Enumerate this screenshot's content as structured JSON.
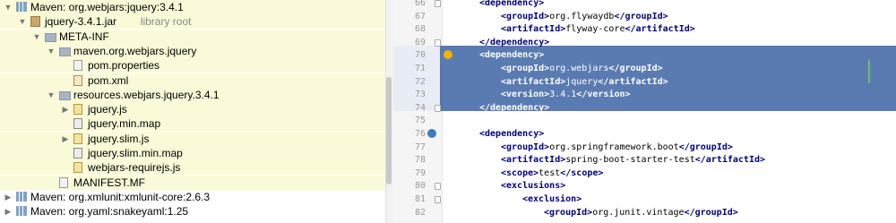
{
  "project_tree": {
    "rows": [
      {
        "label": "Maven: org.webjars:jquery:3.4.1",
        "suffix": "",
        "arrow": "▼",
        "icon": "library-icon"
      },
      {
        "label": "jquery-3.4.1.jar",
        "suffix": "library root",
        "arrow": "▼",
        "icon": "jar-icon"
      },
      {
        "label": "META-INF",
        "suffix": "",
        "arrow": "▼",
        "icon": "folder-icon"
      },
      {
        "label": "maven.org.webjars.jquery",
        "suffix": "",
        "arrow": "▼",
        "icon": "package-icon"
      },
      {
        "label": "pom.properties",
        "suffix": "",
        "arrow": "",
        "icon": "properties-file-icon"
      },
      {
        "label": "pom.xml",
        "suffix": "",
        "arrow": "",
        "icon": "xml-file-icon"
      },
      {
        "label": "resources.webjars.jquery.3.4.1",
        "suffix": "",
        "arrow": "▼",
        "icon": "package-icon"
      },
      {
        "label": "jquery.js",
        "suffix": "",
        "arrow": "▶",
        "icon": "js-file-icon"
      },
      {
        "label": "jquery.min.map",
        "suffix": "",
        "arrow": "",
        "icon": "map-file-icon"
      },
      {
        "label": "jquery.slim.js",
        "suffix": "",
        "arrow": "▶",
        "icon": "js-file-icon"
      },
      {
        "label": "jquery.slim.min.map",
        "suffix": "",
        "arrow": "",
        "icon": "map-file-icon"
      },
      {
        "label": "webjars-requirejs.js",
        "suffix": "",
        "arrow": "",
        "icon": "js-file-icon"
      },
      {
        "label": "MANIFEST.MF",
        "suffix": "",
        "arrow": "",
        "icon": "manifest-file-icon"
      },
      {
        "label": "Maven: org.xmlunit:xmlunit-core:2.6.3",
        "suffix": "",
        "arrow": "▶",
        "icon": "library-icon"
      },
      {
        "label": "Maven: org.yaml:snakeyaml:1.25",
        "suffix": "",
        "arrow": "▶",
        "icon": "library-icon"
      }
    ]
  },
  "editor": {
    "lines": [
      {
        "num": "66",
        "parts": [
          {
            "t": "tag",
            "v": "<dependency>"
          }
        ]
      },
      {
        "num": "67",
        "parts": [
          {
            "t": "tag",
            "v": "<groupId>"
          },
          {
            "t": "txt",
            "v": "org.flywaydb"
          },
          {
            "t": "tag",
            "v": "</groupId>"
          }
        ]
      },
      {
        "num": "68",
        "parts": [
          {
            "t": "tag",
            "v": "<artifactId>"
          },
          {
            "t": "txt",
            "v": "flyway-core"
          },
          {
            "t": "tag",
            "v": "</artifactId>"
          }
        ]
      },
      {
        "num": "69",
        "parts": [
          {
            "t": "tag",
            "v": "</dependency>"
          }
        ]
      },
      {
        "num": "70",
        "parts": [
          {
            "t": "tag",
            "v": "<dependency>"
          }
        ]
      },
      {
        "num": "71",
        "parts": [
          {
            "t": "tag",
            "v": "<groupId>"
          },
          {
            "t": "txt",
            "v": "org.webjars"
          },
          {
            "t": "tag",
            "v": "</groupId>"
          }
        ]
      },
      {
        "num": "72",
        "parts": [
          {
            "t": "tag",
            "v": "<artifactId>"
          },
          {
            "t": "txt",
            "v": "jquery"
          },
          {
            "t": "tag",
            "v": "</artifactId>"
          }
        ]
      },
      {
        "num": "73",
        "parts": [
          {
            "t": "tag",
            "v": "<version>"
          },
          {
            "t": "txt",
            "v": "3.4.1"
          },
          {
            "t": "tag",
            "v": "</version>"
          }
        ]
      },
      {
        "num": "74",
        "parts": [
          {
            "t": "tag",
            "v": "</dependency>"
          }
        ]
      },
      {
        "num": "75",
        "parts": []
      },
      {
        "num": "76",
        "parts": [
          {
            "t": "tag",
            "v": "<dependency>"
          }
        ]
      },
      {
        "num": "77",
        "parts": [
          {
            "t": "tag",
            "v": "<groupId>"
          },
          {
            "t": "txt",
            "v": "org.springframework.boot"
          },
          {
            "t": "tag",
            "v": "</groupId>"
          }
        ]
      },
      {
        "num": "78",
        "parts": [
          {
            "t": "tag",
            "v": "<artifactId>"
          },
          {
            "t": "txt",
            "v": "spring-boot-starter-test"
          },
          {
            "t": "tag",
            "v": "</artifactId>"
          }
        ]
      },
      {
        "num": "79",
        "parts": [
          {
            "t": "tag",
            "v": "<scope>"
          },
          {
            "t": "txt",
            "v": "test"
          },
          {
            "t": "tag",
            "v": "</scope>"
          }
        ]
      },
      {
        "num": "80",
        "parts": [
          {
            "t": "tag",
            "v": "<exclusions>"
          }
        ]
      },
      {
        "num": "81",
        "parts": [
          {
            "t": "tag",
            "v": "<exclusion>"
          }
        ]
      },
      {
        "num": "82",
        "parts": [
          {
            "t": "tag",
            "v": "<groupId>"
          },
          {
            "t": "txt",
            "v": "org.junit.vintage"
          },
          {
            "t": "tag",
            "v": "</groupId>"
          }
        ]
      }
    ]
  },
  "colors": {
    "selection": "#3d64a4",
    "tag": "#000080",
    "tree_highlight": "#fafad8"
  }
}
